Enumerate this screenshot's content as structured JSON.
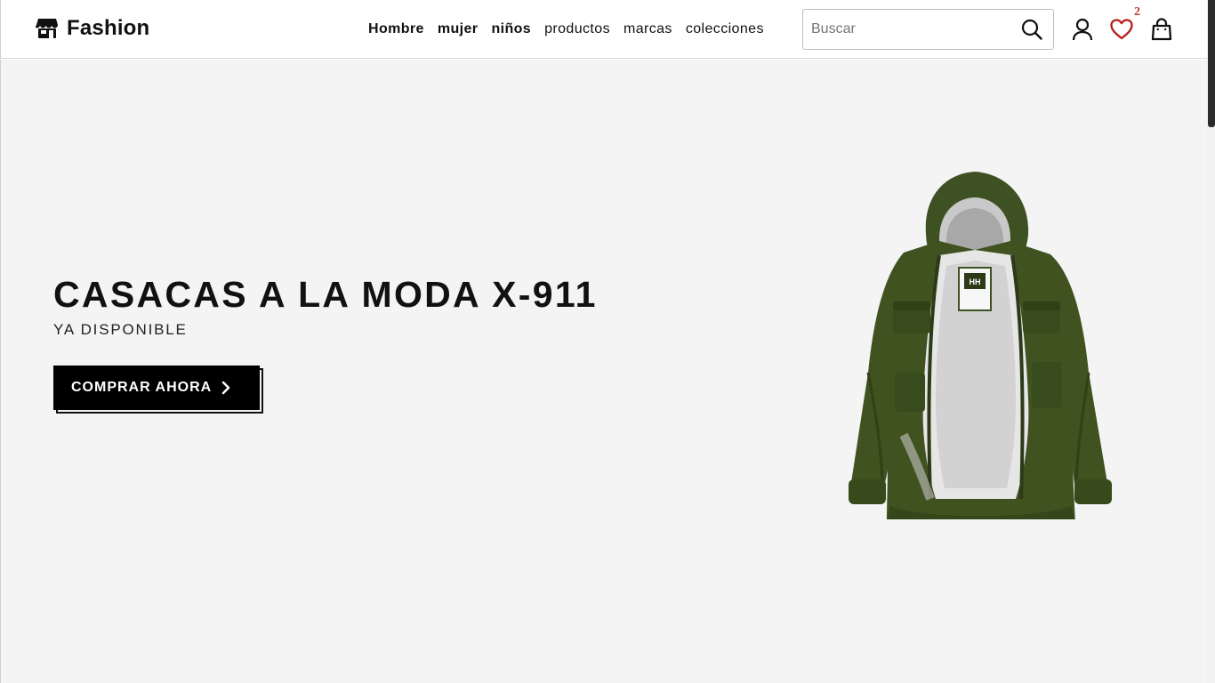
{
  "brand": {
    "name": "Fashion",
    "logo_icon": "store-icon"
  },
  "nav": {
    "items": [
      {
        "label": "Hombre",
        "bold": true
      },
      {
        "label": "mujer",
        "bold": true
      },
      {
        "label": "niños",
        "bold": true
      },
      {
        "label": "productos",
        "bold": false
      },
      {
        "label": "marcas",
        "bold": false
      },
      {
        "label": "colecciones",
        "bold": false
      }
    ]
  },
  "search": {
    "placeholder": "Buscar",
    "value": "",
    "icon": "search-icon"
  },
  "header_actions": {
    "account_icon": "user-icon",
    "wishlist_icon": "heart-icon",
    "wishlist_count": "2",
    "cart_icon": "shopping-bag-icon"
  },
  "hero": {
    "title": "CASACAS A LA MODA X-911",
    "subtitle": "YA DISPONIBLE",
    "cta_label": "COMPRAR AHORA",
    "cta_icon": "chevron-right-icon",
    "image": "green-jacket-image"
  },
  "colors": {
    "hero_background": "#f4f4f4",
    "accent_button": "#000000",
    "badge": "#c0392b",
    "heart": "#b71c1c",
    "jacket": "#3f5220"
  }
}
